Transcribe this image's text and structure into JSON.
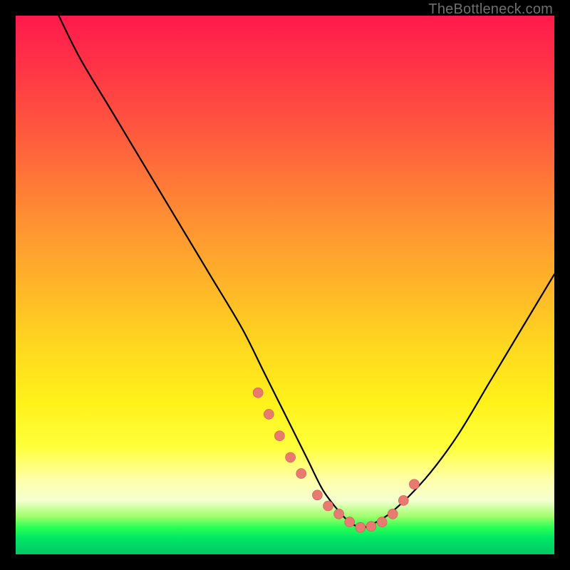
{
  "watermark": "TheBottleneck.com",
  "chart_data": {
    "type": "line",
    "title": "",
    "xlabel": "",
    "ylabel": "",
    "xlim": [
      0,
      100
    ],
    "ylim": [
      0,
      100
    ],
    "series": [
      {
        "name": "bottleneck-curve",
        "x": [
          8,
          12,
          18,
          24,
          30,
          36,
          42,
          46,
          50,
          54,
          57,
          60,
          62,
          64,
          66,
          70,
          76,
          82,
          88,
          94,
          100
        ],
        "y": [
          100,
          92,
          82,
          72,
          62,
          52,
          42,
          34,
          26,
          18,
          12,
          8,
          6,
          5,
          5.5,
          8,
          14,
          22,
          32,
          42,
          52
        ]
      }
    ],
    "markers": {
      "name": "highlight-dots",
      "x": [
        45,
        47,
        49,
        51,
        53,
        56,
        58,
        60,
        62,
        64,
        66,
        68,
        70,
        72,
        74
      ],
      "y": [
        30,
        26,
        22,
        18,
        15,
        11,
        9,
        7.5,
        6,
        5,
        5.2,
        6,
        7.5,
        10,
        13
      ]
    },
    "background_gradient": {
      "top": "#ff1a4b",
      "mid": "#ffe41f",
      "bottom": "#00c766"
    }
  }
}
